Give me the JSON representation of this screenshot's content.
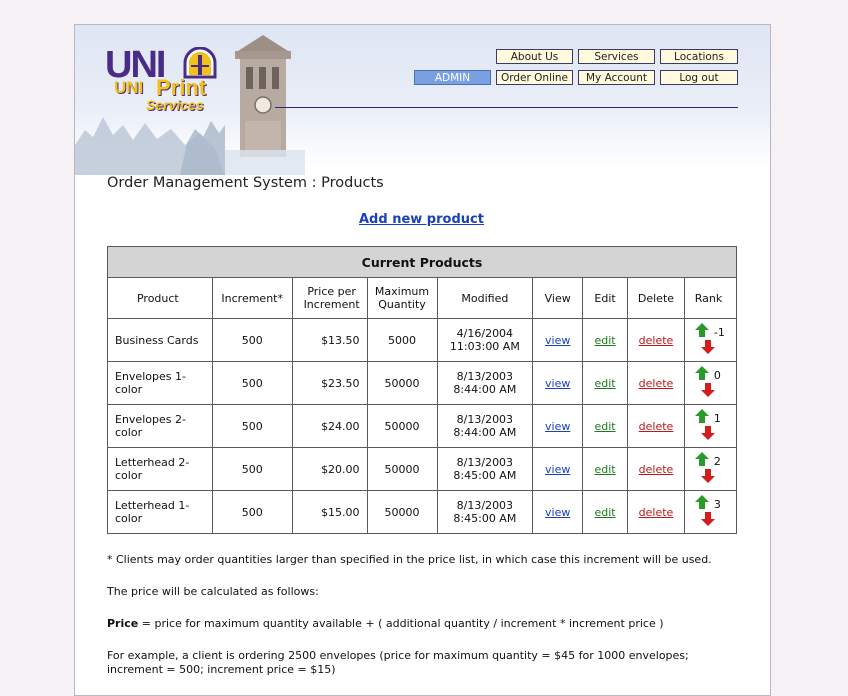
{
  "header": {
    "logo": {
      "main": "UNI",
      "sub_uni": "UNI",
      "sub_print": "Print",
      "sub_services": "Services"
    },
    "nav_top": [
      "About Us",
      "Services",
      "Locations"
    ],
    "nav_bottom": [
      "ADMIN",
      "Order Online",
      "My Account",
      "Log out"
    ],
    "admin_color": "#7aa0e2",
    "button_color": "#fffbdc"
  },
  "page_title": "Order Management System : Products",
  "add_link": "Add new product",
  "table": {
    "caption": "Current Products",
    "columns": {
      "product": "Product",
      "increment": "Increment*",
      "price": "Price per Increment",
      "max": "Maximum Quantity",
      "modified": "Modified",
      "view": "View",
      "edit": "Edit",
      "delete": "Delete",
      "rank": "Rank"
    },
    "rows": [
      {
        "product": "Business Cards",
        "increment": "500",
        "price": "$13.50",
        "max": "5000",
        "date": "4/16/2004",
        "time": "11:03:00 AM",
        "view": "view",
        "edit": "edit",
        "delete": "delete",
        "rank": "-1"
      },
      {
        "product": "Envelopes 1-color",
        "increment": "500",
        "price": "$23.50",
        "max": "50000",
        "date": "8/13/2003",
        "time": "8:44:00 AM",
        "view": "view",
        "edit": "edit",
        "delete": "delete",
        "rank": "0"
      },
      {
        "product": "Envelopes 2-color",
        "increment": "500",
        "price": "$24.00",
        "max": "50000",
        "date": "8/13/2003",
        "time": "8:44:00 AM",
        "view": "view",
        "edit": "edit",
        "delete": "delete",
        "rank": "1"
      },
      {
        "product": "Letterhead 2-color",
        "increment": "500",
        "price": "$20.00",
        "max": "50000",
        "date": "8/13/2003",
        "time": "8:45:00 AM",
        "view": "view",
        "edit": "edit",
        "delete": "delete",
        "rank": "2"
      },
      {
        "product": "Letterhead 1-color",
        "increment": "500",
        "price": "$15.00",
        "max": "50000",
        "date": "8/13/2003",
        "time": "8:45:00 AM",
        "view": "view",
        "edit": "edit",
        "delete": "delete",
        "rank": "3"
      }
    ]
  },
  "notes": {
    "footnote": "* Clients may order quantities larger than specified in the price list, in which case this increment will be used.",
    "calc_intro": "The price will be calculated as follows:",
    "formula_label": "Price",
    "formula_text": " = price for maximum quantity available + ( additional quantity / increment * increment price )",
    "example": "For example, a client is ordering 2500 envelopes (price for maximum quantity = $45 for 1000 envelopes; increment = 500; increment price = $15)"
  },
  "icons": {
    "rank_up": "green-up-arrow-icon",
    "rank_down": "red-down-arrow-icon"
  }
}
